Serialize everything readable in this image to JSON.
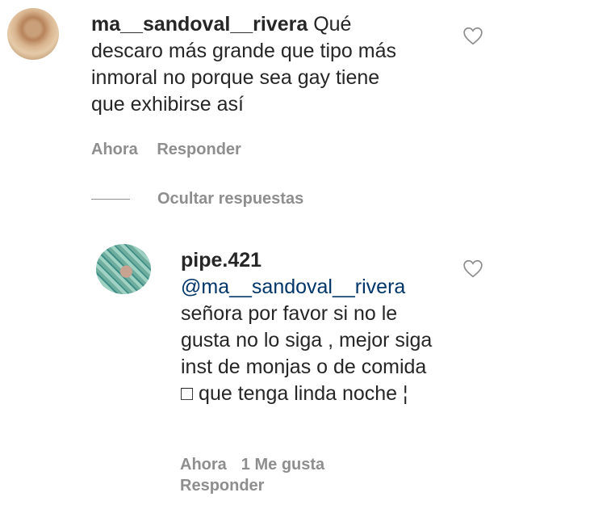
{
  "comment1": {
    "username": "ma__sandoval__rivera",
    "text": "Qué descaro más grande que tipo más inmoral no porque sea gay tiene que exhibirse así",
    "time": "Ahora",
    "reply_label": "Responder"
  },
  "hide_replies": {
    "label": "Ocultar respuestas"
  },
  "comment2": {
    "username": "pipe.421",
    "mention": "@ma__sandoval__rivera",
    "text": "señora por favor si no le gusta no lo siga , mejor siga inst de monjas o de comida □ que tenga linda noche ¦",
    "time": "Ahora",
    "likes_label": "1 Me gusta",
    "reply_label": "Responder"
  },
  "icons": {
    "like": "heart-outline-icon"
  },
  "colors": {
    "text": "#262626",
    "secondary": "#8e8e8e",
    "mention": "#003569"
  }
}
